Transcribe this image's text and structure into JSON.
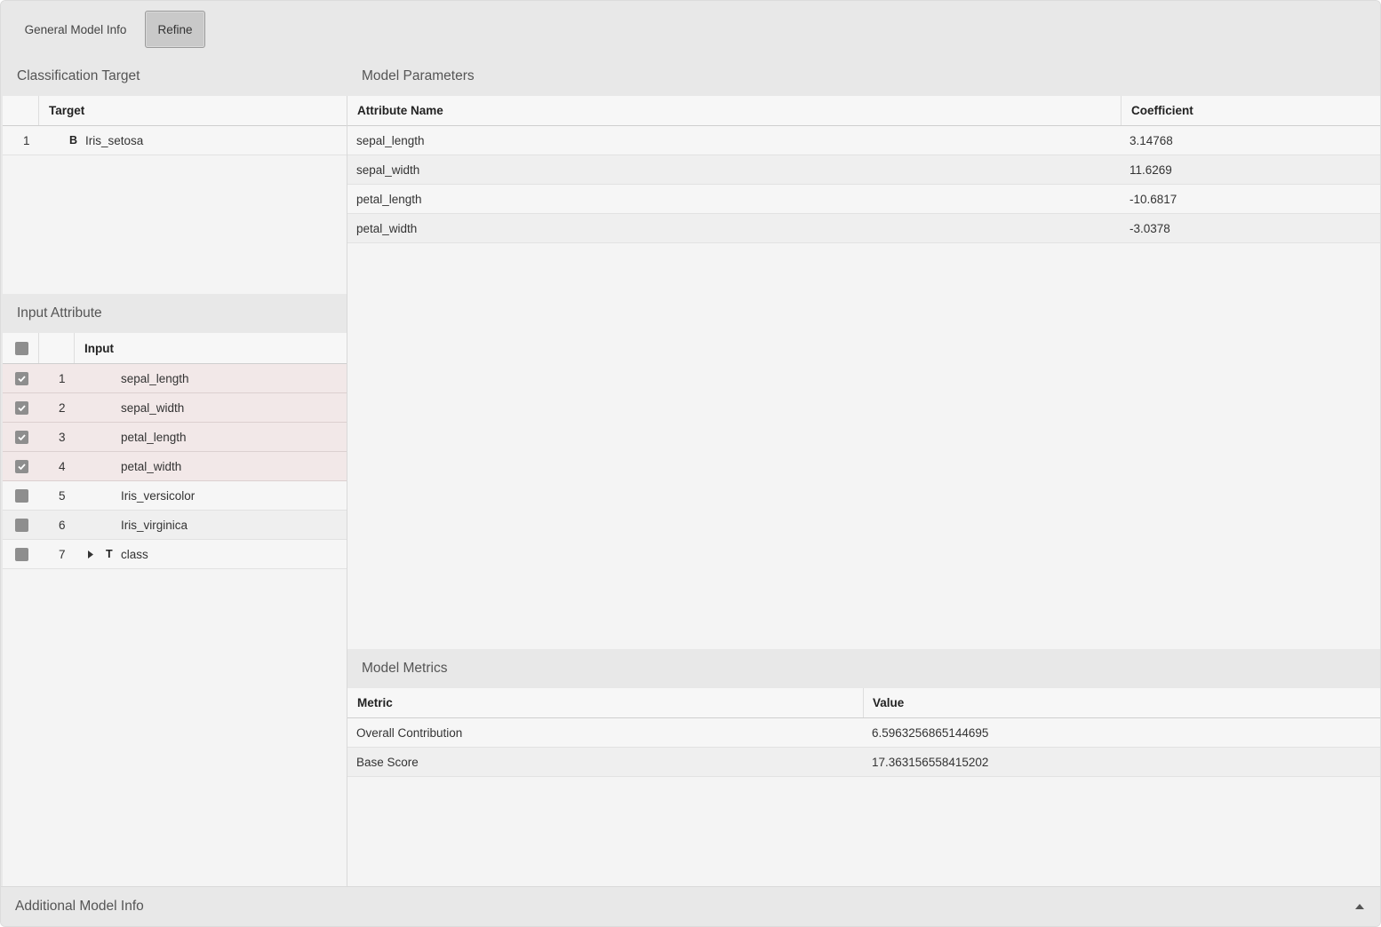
{
  "tabs": {
    "general": "General Model Info",
    "refine": "Refine"
  },
  "classification_target": {
    "title": "Classification Target",
    "header": "Target",
    "rows": [
      {
        "index": "1",
        "type": "B",
        "name": "Iris_setosa"
      }
    ]
  },
  "input_attribute": {
    "title": "Input Attribute",
    "header": "Input",
    "rows": [
      {
        "index": "1",
        "name": "sepal_length",
        "checked": true,
        "type": ""
      },
      {
        "index": "2",
        "name": "sepal_width",
        "checked": true,
        "type": ""
      },
      {
        "index": "3",
        "name": "petal_length",
        "checked": true,
        "type": ""
      },
      {
        "index": "4",
        "name": "petal_width",
        "checked": true,
        "type": ""
      },
      {
        "index": "5",
        "name": "Iris_versicolor",
        "checked": false,
        "type": ""
      },
      {
        "index": "6",
        "name": "Iris_virginica",
        "checked": false,
        "type": ""
      },
      {
        "index": "7",
        "name": "class",
        "checked": false,
        "type": "T"
      }
    ]
  },
  "model_parameters": {
    "title": "Model Parameters",
    "headers": [
      "Attribute Name",
      "Coefficient"
    ],
    "rows": [
      [
        "sepal_length",
        "3.14768"
      ],
      [
        "sepal_width",
        "11.6269"
      ],
      [
        "petal_length",
        "-10.6817"
      ],
      [
        "petal_width",
        "-3.0378"
      ]
    ]
  },
  "model_metrics": {
    "title": "Model Metrics",
    "headers": [
      "Metric",
      "Value"
    ],
    "rows": [
      [
        "Overall Contribution",
        "6.5963256865144695"
      ],
      [
        "Base Score",
        "17.363156558415202"
      ]
    ]
  },
  "footer": {
    "title": "Additional Model Info",
    "icon": "caret-up-icon"
  },
  "colors": {
    "selected_row": "#f2e8e8",
    "checkbox": "#8e8e8e"
  }
}
